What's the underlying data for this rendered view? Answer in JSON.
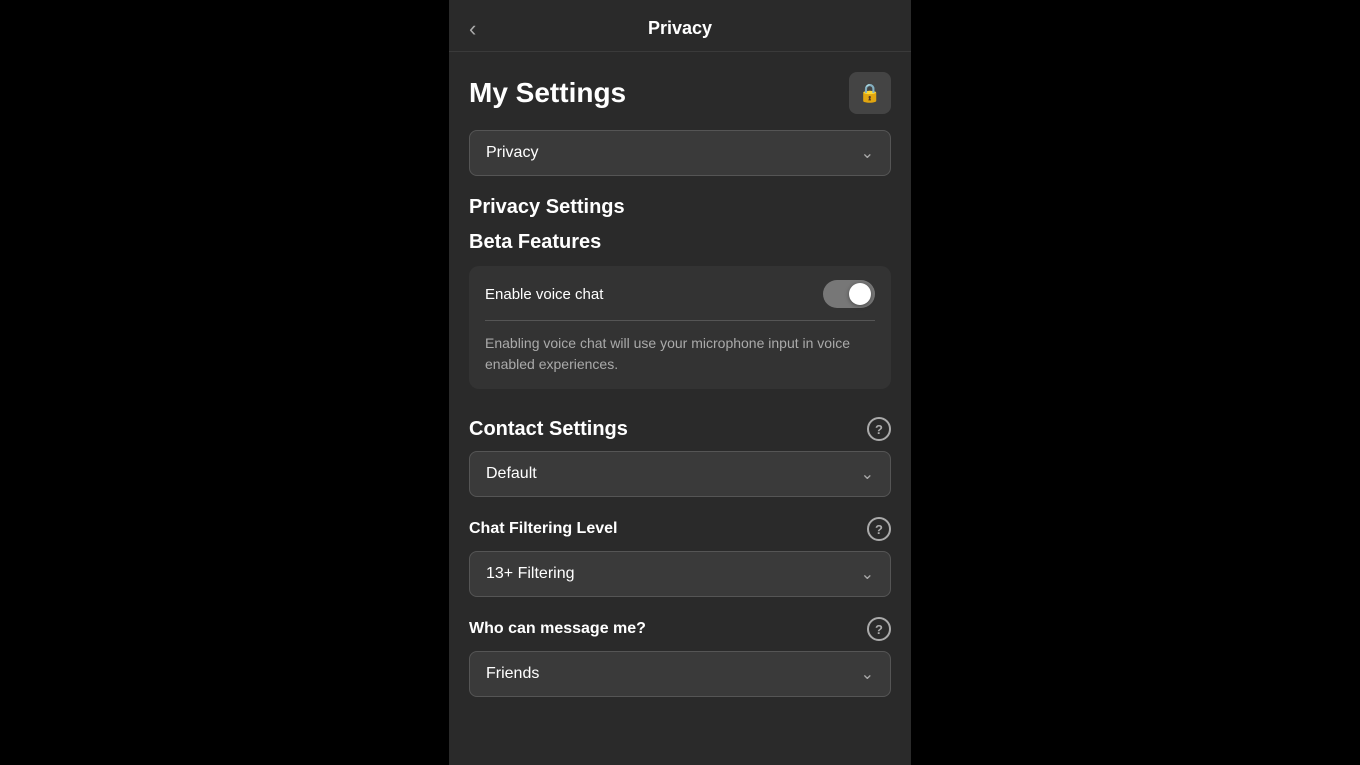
{
  "header": {
    "back_label": "‹",
    "title": "Privacy"
  },
  "my_settings": {
    "title": "My Settings",
    "lock_icon": "🔒"
  },
  "privacy_dropdown": {
    "value": "Privacy",
    "arrow": "⌄"
  },
  "privacy_settings": {
    "heading": "Privacy Settings"
  },
  "beta_features": {
    "heading": "Beta Features",
    "toggle_label": "Enable voice chat",
    "description": "Enabling voice chat will use your microphone input in voice enabled experiences."
  },
  "contact_settings": {
    "heading": "Contact Settings",
    "help_label": "?",
    "dropdown": {
      "value": "Default",
      "arrow": "⌄"
    }
  },
  "chat_filtering": {
    "heading": "Chat Filtering Level",
    "help_label": "?",
    "dropdown": {
      "value": "13+ Filtering",
      "arrow": "⌄"
    }
  },
  "who_can_message": {
    "heading": "Who can message me?",
    "help_label": "?",
    "dropdown": {
      "value": "Friends",
      "arrow": "⌄"
    }
  }
}
